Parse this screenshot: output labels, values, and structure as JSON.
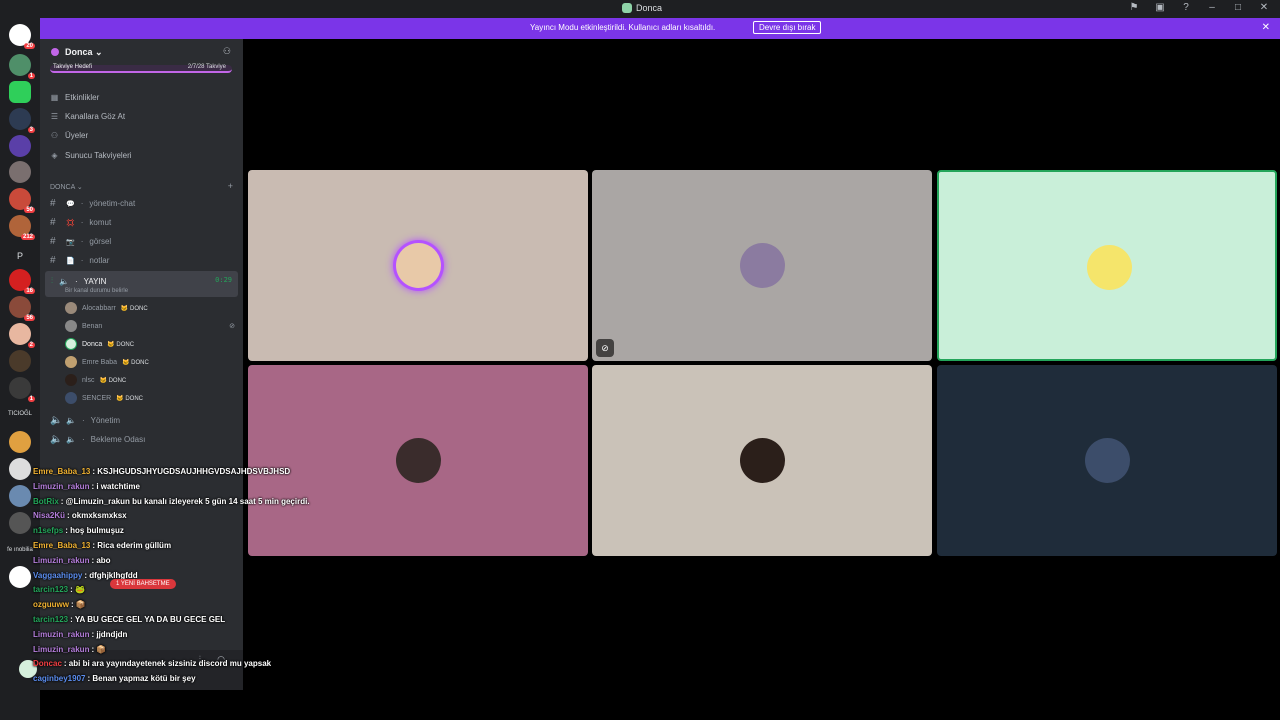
{
  "titlebar": {
    "title": "Donca",
    "icons": [
      "inbox-flag-icon",
      "window-icon",
      "help-icon",
      "minimize-icon",
      "maximize-icon",
      "close-icon"
    ]
  },
  "banner": {
    "message": "Yayıncı Modu etkinleştirildi. Kullanıcı adları kısaltıldı.",
    "button": "Devre dışı bırak",
    "color": "#7b35e8"
  },
  "servers": {
    "home_badge": "20",
    "badges": [
      "1",
      "3",
      "50",
      "212",
      "16",
      "56",
      "2",
      "1"
    ],
    "text_items": [
      "P",
      "TICIOĞL",
      "fe ınobilia"
    ]
  },
  "sidebar": {
    "server_name": "Donca",
    "boost": {
      "left": "Takviye Hedefi",
      "right": "2/7/28 Takviye"
    },
    "nav": [
      "Etkinlikler",
      "Kanallara Göz At",
      "Üyeler",
      "Sunucu Takviyeleri"
    ],
    "category": "DONCA",
    "channels": [
      {
        "emoji": "💬",
        "name": "yönetim-chat"
      },
      {
        "emoji": "💢",
        "name": "komut"
      },
      {
        "emoji": "📷",
        "name": "görsel"
      },
      {
        "emoji": "📄",
        "name": "notlar"
      }
    ],
    "active_voice": {
      "name": "YAYIN",
      "timer": "0:29",
      "status": "Bir kanal durumu belirle"
    },
    "voice_users": [
      {
        "name": "Alocabbarr",
        "tag": "DONC"
      },
      {
        "name": "Benan",
        "tag": ""
      },
      {
        "name": "Donca",
        "tag": "DONC"
      },
      {
        "name": "Emre Baba",
        "tag": "DONC"
      },
      {
        "name": "nlsc",
        "tag": "DONC"
      },
      {
        "name": "SENCER",
        "tag": "DONC"
      }
    ],
    "other_voice": [
      "Yönetim",
      "Bekleme Odası"
    ]
  },
  "chat": {
    "new_mentions": "1 YENİ BAHSETME",
    "lines": [
      {
        "user": "Emre_Baba_13",
        "color": "#f0b232",
        "text": ": KSJHGUDSJHYUGDSAUJHHGVDSAJHDSVBJHSD"
      },
      {
        "user": "Limuzin_rakun",
        "color": "#b57edc",
        "text": ": i watchtime"
      },
      {
        "user": "BotRix",
        "color": "#23a55a",
        "text": ": @Limuzin_rakun bu kanalı izleyerek 5 gün 14 saat 5 min geçirdi."
      },
      {
        "user": "Nisa2Kü",
        "color": "#b57edc",
        "text": ": okmxksmxksx"
      },
      {
        "user": "n1sefps",
        "color": "#23a55a",
        "text": ": hoş bulmuşuz"
      },
      {
        "user": "Emre_Baba_13",
        "color": "#f0b232",
        "text": ": Rica ederim güllüm"
      },
      {
        "user": "Limuzin_rakun",
        "color": "#b57edc",
        "text": ": abo"
      },
      {
        "user": "Vaggaahippy",
        "color": "#5b8def",
        "text": ": dfghjklhgfdd"
      },
      {
        "user": "tarcin123",
        "color": "#23a55a",
        "text": ": 🐸"
      },
      {
        "user": "ozguuww",
        "color": "#f0b232",
        "text": ": 📦"
      },
      {
        "user": "tarcin123",
        "color": "#23a55a",
        "text": ": YA BU GECE GEL YA DA BU GECE GEL"
      },
      {
        "user": "Limuzin_rakun",
        "color": "#b57edc",
        "text": ": jjdndjdn"
      },
      {
        "user": "Limuzin_rakun",
        "color": "#b57edc",
        "text": ": 📦"
      },
      {
        "user": "Doncac",
        "color": "#f23f43",
        "text": ": abi bi ara yayındayetenek sizsiniz discord mu yapsak"
      },
      {
        "user": "caginbey1907",
        "color": "#5b8def",
        "text": ": Benan yapmaz kötü bir şey"
      }
    ]
  },
  "tiles": [
    {
      "bg": "#c9bbb2",
      "avatar": "#e8c9a8",
      "ring": "#b452ff",
      "muted": false,
      "border": ""
    },
    {
      "bg": "#aaa6a4",
      "avatar": "#8b7ba0",
      "ring": "",
      "muted": true,
      "border": ""
    },
    {
      "bg": "#c9efd9",
      "avatar": "#f5e56b",
      "ring": "",
      "muted": false,
      "border": "#23a55a"
    },
    {
      "bg": "#a86786",
      "avatar": "#3a2c2c",
      "ring": "",
      "muted": false,
      "border": ""
    },
    {
      "bg": "#cac2b8",
      "avatar": "#2b1f1a",
      "ring": "",
      "muted": false,
      "border": ""
    },
    {
      "bg": "#1f2c3a",
      "avatar": "#3c4d6a",
      "ring": "",
      "muted": false,
      "border": ""
    }
  ]
}
